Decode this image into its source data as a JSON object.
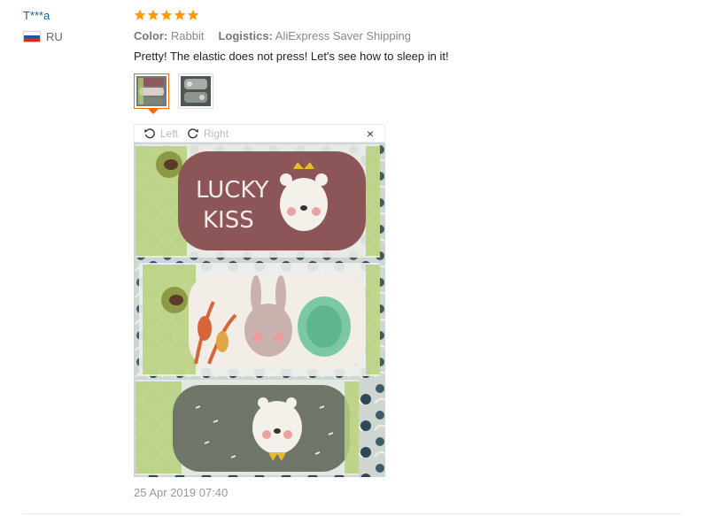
{
  "reviewer": {
    "name": "T***a",
    "country": "RU",
    "flag": [
      "#ffffff",
      "#1c57a5",
      "#d52b1e"
    ]
  },
  "rating": {
    "stars": 5,
    "max": 5,
    "color": "#ff9a00"
  },
  "meta": {
    "color_label": "Color:",
    "color_value": "Rabbit",
    "logistics_label": "Logistics:",
    "logistics_value": "AliExpress Saver Shipping"
  },
  "review_text": "Pretty! The elastic does not press! Let's see how to sleep in it!",
  "viewer": {
    "left_label": "Left",
    "right_label": "Right",
    "close_symbol": "×"
  },
  "photo": {
    "mask1_text_line1": "LUCKY",
    "mask1_text_line2": "KISS"
  },
  "date": "25 Apr 2019 07:40"
}
